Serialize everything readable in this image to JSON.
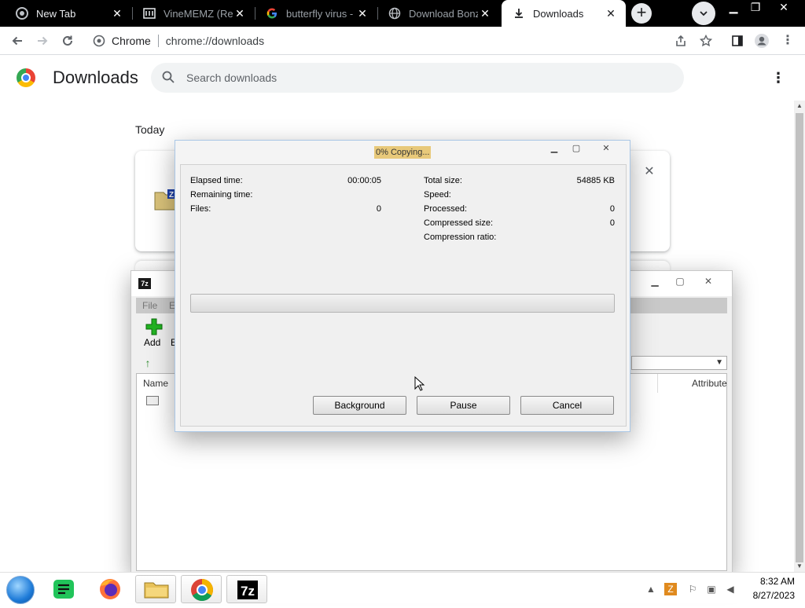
{
  "browser": {
    "tabs": [
      {
        "title": "New Tab",
        "icon": "chrome-icon",
        "active": false
      },
      {
        "title": "VineMEMZ (Read",
        "icon": "vinememz-icon",
        "active": false
      },
      {
        "title": "butterfly virus - G",
        "icon": "google-icon",
        "active": false
      },
      {
        "title": "Download Bonzi",
        "icon": "globe-icon",
        "active": false
      },
      {
        "title": "Downloads",
        "icon": "download-icon",
        "active": true
      }
    ],
    "new_tab_symbol": "+",
    "omnibox": {
      "site_label": "Chrome",
      "url": "chrome://downloads"
    }
  },
  "downloads_page": {
    "title": "Downloads",
    "search_placeholder": "Search downloads",
    "section_label": "Today",
    "card_close_symbol": "✕"
  },
  "progress_dialog": {
    "title": "0% Copying...",
    "progress_percent": 0,
    "left_fields": [
      {
        "label": "Elapsed time:",
        "value": "00:00:05"
      },
      {
        "label": "Remaining time:",
        "value": ""
      },
      {
        "label": "Files:",
        "value": "0"
      }
    ],
    "right_fields": [
      {
        "label": "Total size:",
        "value": "54885 KB"
      },
      {
        "label": "Speed:",
        "value": ""
      },
      {
        "label": "Processed:",
        "value": "0"
      },
      {
        "label": "Compressed size:",
        "value": "0"
      },
      {
        "label": "Compression ratio:",
        "value": ""
      }
    ],
    "buttons": {
      "background": "Background",
      "pause": "Pause",
      "cancel": "Cancel"
    }
  },
  "file_manager": {
    "app_icon_text": "7z",
    "menu": [
      "File",
      "Ed"
    ],
    "toolbar": {
      "add": "Add",
      "extract": "Ex"
    },
    "columns": {
      "name": "Name",
      "attributes": "Attribute"
    }
  },
  "taskbar": {
    "time": "8:32 AM",
    "date": "8/27/2023",
    "apps": [
      "start-orb",
      "notes-app-icon",
      "firefox-icon",
      "file-explorer-icon",
      "chrome-icon",
      "7zip-icon"
    ]
  },
  "colors": {
    "progress_fill": "#06b025",
    "title_highlight": "#e8c97a",
    "accent": "#1a73e8"
  }
}
